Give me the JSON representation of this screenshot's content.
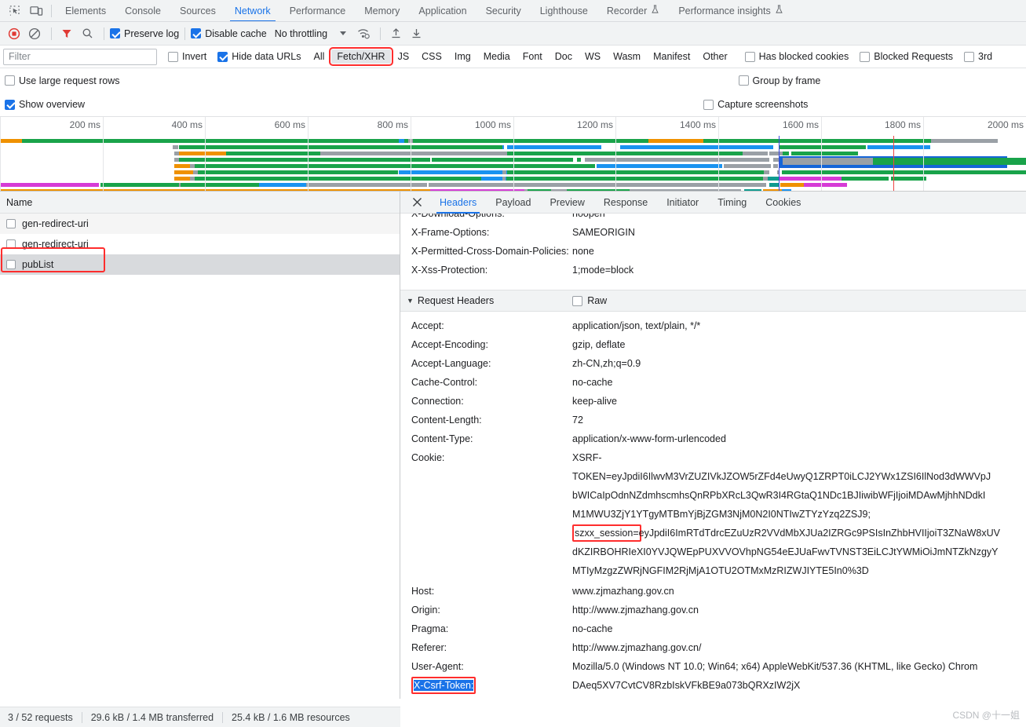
{
  "devtools_tabs": [
    {
      "label": "Elements",
      "active": false,
      "flask": false
    },
    {
      "label": "Console",
      "active": false,
      "flask": false
    },
    {
      "label": "Sources",
      "active": false,
      "flask": false
    },
    {
      "label": "Network",
      "active": true,
      "flask": false
    },
    {
      "label": "Performance",
      "active": false,
      "flask": false
    },
    {
      "label": "Memory",
      "active": false,
      "flask": false
    },
    {
      "label": "Application",
      "active": false,
      "flask": false
    },
    {
      "label": "Security",
      "active": false,
      "flask": false
    },
    {
      "label": "Lighthouse",
      "active": false,
      "flask": false
    },
    {
      "label": "Recorder",
      "active": false,
      "flask": true
    },
    {
      "label": "Performance insights",
      "active": false,
      "flask": true
    }
  ],
  "toolbar": {
    "record_icon": "record-stop-icon",
    "clear_icon": "clear-icon",
    "filter_icon": "filter-funnel-icon",
    "search_icon": "search-icon",
    "preserve_log": {
      "label": "Preserve log",
      "checked": true
    },
    "disable_cache": {
      "label": "Disable cache",
      "checked": true
    },
    "throttling": {
      "value": "No throttling"
    },
    "wifi_icon": "network-conditions-icon",
    "import_icon": "import-har-icon",
    "export_icon": "export-har-icon"
  },
  "filter_bar": {
    "placeholder": "Filter",
    "value": "",
    "invert": {
      "label": "Invert",
      "checked": false
    },
    "hide_data_urls": {
      "label": "Hide data URLs",
      "checked": true
    },
    "types": [
      "All",
      "Fetch/XHR",
      "JS",
      "CSS",
      "Img",
      "Media",
      "Font",
      "Doc",
      "WS",
      "Wasm",
      "Manifest",
      "Other"
    ],
    "selected_type": "Fetch/XHR",
    "highlighted_type": "Fetch/XHR",
    "has_blocked_cookies": {
      "label": "Has blocked cookies",
      "checked": false
    },
    "blocked_requests": {
      "label": "Blocked Requests",
      "checked": false
    },
    "third_party": {
      "label": "3rd",
      "checked": false
    }
  },
  "options": {
    "use_large_request_rows": {
      "label": "Use large request rows",
      "checked": false
    },
    "show_overview": {
      "label": "Show overview",
      "checked": true
    },
    "group_by_frame": {
      "label": "Group by frame",
      "checked": false
    },
    "capture_screenshots": {
      "label": "Capture screenshots",
      "checked": false
    }
  },
  "overview": {
    "ticks": [
      "200 ms",
      "400 ms",
      "600 ms",
      "800 ms",
      "1000 ms",
      "1200 ms",
      "1400 ms",
      "1600 ms",
      "1800 ms",
      "2000 ms"
    ],
    "dom_content_loaded_marker_color": "#3b49df",
    "load_marker_color": "#ef4444",
    "colors": {
      "green": "#19a34a",
      "blue": "#1a93f0",
      "orange": "#ef9100",
      "gray": "#9aa0a6",
      "magenta": "#d63bd6",
      "teal": "#0f9b8e",
      "darkblue": "#1565d8"
    }
  },
  "request_list": {
    "column_header": "Name",
    "rows": [
      {
        "name": "gen-redirect-uri",
        "selected": false,
        "highlighted": false
      },
      {
        "name": "gen-redirect-uri",
        "selected": false,
        "highlighted": false
      },
      {
        "name": "pubList",
        "selected": true,
        "highlighted": true
      }
    ]
  },
  "detail_panel": {
    "close_icon": "close-icon",
    "tabs": [
      "Headers",
      "Payload",
      "Preview",
      "Response",
      "Initiator",
      "Timing",
      "Cookies"
    ],
    "active_tab": "Headers",
    "response_headers_partial": [
      {
        "name": "X-Download-Options:",
        "value": "noopen"
      },
      {
        "name": "X-Frame-Options:",
        "value": "SAMEORIGIN"
      },
      {
        "name": "X-Permitted-Cross-Domain-Policies:",
        "value": "none"
      },
      {
        "name": "X-Xss-Protection:",
        "value": "1;mode=block"
      }
    ],
    "request_headers_section": {
      "title": "Request Headers",
      "raw_toggle": {
        "label": "Raw",
        "checked": false
      }
    },
    "request_headers": [
      {
        "name": "Accept:",
        "value": "application/json, text/plain, */*"
      },
      {
        "name": "Accept-Encoding:",
        "value": "gzip, deflate"
      },
      {
        "name": "Accept-Language:",
        "value": "zh-CN,zh;q=0.9"
      },
      {
        "name": "Cache-Control:",
        "value": "no-cache"
      },
      {
        "name": "Connection:",
        "value": "keep-alive"
      },
      {
        "name": "Content-Length:",
        "value": "72"
      },
      {
        "name": "Content-Type:",
        "value": "application/x-www-form-urlencoded"
      }
    ],
    "cookie_header": {
      "name": "Cookie:",
      "lines": [
        "XSRF-",
        "TOKEN=eyJpdiI6IlwvM3VrZUZIVkJZOW5rZFd4eUwyQ1ZRPT0iLCJ2YWx1ZSI6IlNod3dWWVpJ",
        "bWICaIpOdnNZdmhscmhsQnRPbXRcL3QwR3I4RGtaQ1NDc1BJIiwibWFjIjoiMDAwMjhhNDdkI",
        "M1MWU3ZjY1YTgyMTBmYjBjZGM3NjM0N2I0NTIwZTYzYzq2ZSJ9;"
      ],
      "session_label": "szxx_session=",
      "session_lines": [
        "eyJpdiI6ImRTdTdrcEZuUzR2VVdMbXJUa2IZRGc9PSIsInZhbHVIIjoiT3ZNaW8xUV",
        "dKZIRBOHRIeXI0YVJQWEpPUXVVOVhpNG54eEJUaFwvTVNST3EiLCJtYWMiOiJmNTZkNzgyY",
        "MTIyMzgzZWRjNGFIM2RjMjA1OTU2OTMxMzRIZWJIYTE5In0%3D"
      ]
    },
    "tail_headers": [
      {
        "name": "Host:",
        "value": "www.zjmazhang.gov.cn"
      },
      {
        "name": "Origin:",
        "value": "http://www.zjmazhang.gov.cn"
      },
      {
        "name": "Pragma:",
        "value": "no-cache"
      },
      {
        "name": "Referer:",
        "value": "http://www.zjmazhang.gov.cn/"
      },
      {
        "name": "User-Agent:",
        "value": "Mozilla/5.0 (Windows NT 10.0; Win64; x64) AppleWebKit/537.36 (KHTML, like Gecko) Chrom"
      }
    ],
    "csrf_header": {
      "name": "X-Csrf-Token:",
      "value": "DAeq5XV7CvtCV8RzbIskVFkBE9a073bQRXzIW2jX"
    }
  },
  "status_bar": {
    "requests": "3 / 52 requests",
    "transferred": "29.6 kB / 1.4 MB transferred",
    "resources": "25.4 kB / 1.6 MB resources"
  },
  "watermark": "CSDN @十一姐"
}
